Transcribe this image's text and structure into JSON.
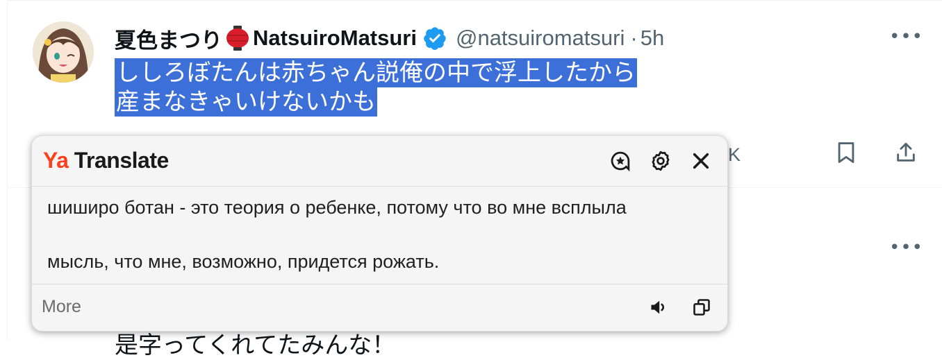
{
  "tweet": {
    "display_name": "夏色まつり",
    "display_name_suffix": "NatsuiroMatsuri",
    "handle": "@natsuiromatsuri",
    "separator": "·",
    "time": "5h",
    "text_line1": "ししろぼたんは赤ちゃん説俺の中で浮上したから",
    "text_line2": "産まなきゃいけないかも",
    "partial_count": "K",
    "more_label": "•••"
  },
  "next_tweet": {
    "more_label": "•••",
    "cut_text": "是字ってくれてたみんな！"
  },
  "translate_popup": {
    "brand_ya": "Ya",
    "brand_name": "Translate",
    "translation_line1": "шиширо ботан - это теория о ребенке, потому что во мне всплыла",
    "translation_line2": "мысль, что мне, возможно, придется рожать.",
    "more_label": "More"
  },
  "colors": {
    "selection": "#3d6fd9",
    "verified": "#1d9bf0",
    "yandex_red": "#fc3f1d",
    "muted": "#536471"
  },
  "icons": [
    "favorite-star-icon",
    "settings-gear-icon",
    "close-icon",
    "speaker-icon",
    "copy-icon",
    "bookmark-icon",
    "share-icon",
    "verified-badge-icon",
    "lantern-emoji-icon"
  ]
}
